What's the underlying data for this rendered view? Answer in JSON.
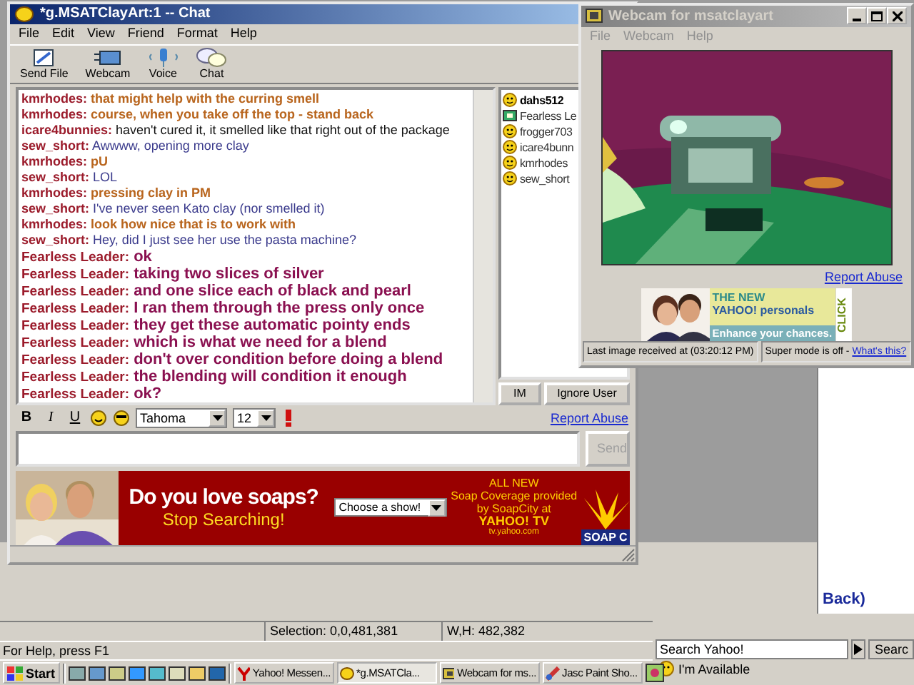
{
  "chat_window": {
    "title": "*g.MSATClayArt:1 -- Chat",
    "menu": [
      "File",
      "Edit",
      "View",
      "Friend",
      "Format",
      "Help"
    ],
    "toolbar": [
      {
        "label": "Send File",
        "kind": "file"
      },
      {
        "label": "Webcam",
        "kind": "webcam"
      },
      {
        "label": "Voice",
        "kind": "voice"
      },
      {
        "label": "Chat",
        "kind": "chat"
      }
    ],
    "messages": [
      {
        "sender": "kmrhodes:",
        "text": "that might help with the curring smell",
        "kind": "bold",
        "color": "#b8641c"
      },
      {
        "sender": "kmrhodes:",
        "text": "course, when you take off the top - stand back",
        "kind": "bold",
        "color": "#b8641c"
      },
      {
        "sender": "icare4bunnies:",
        "text": "haven't cured it, it smelled like that right out of the package",
        "kind": "plain",
        "color": "#111111"
      },
      {
        "sender": "sew_short:",
        "text": "Awwww, opening more clay",
        "kind": "plain",
        "color": "#3a3a8c"
      },
      {
        "sender": "kmrhodes:",
        "text": "pU",
        "kind": "bold",
        "color": "#b8641c"
      },
      {
        "sender": "sew_short:",
        "text": "LOL",
        "kind": "plain",
        "color": "#3a3a8c"
      },
      {
        "sender": "kmrhodes:",
        "text": "pressing clay in PM",
        "kind": "bold",
        "color": "#b8641c"
      },
      {
        "sender": "sew_short:",
        "text": "I've never seen Kato clay (nor smelled it)",
        "kind": "plain",
        "color": "#3a3a8c"
      },
      {
        "sender": "kmrhodes:",
        "text": "look how nice that is to work with",
        "kind": "bold",
        "color": "#b8641c"
      },
      {
        "sender": "sew_short:",
        "text": "Hey, did I just see her use the pasta machine?",
        "kind": "plain",
        "color": "#3a3a8c"
      },
      {
        "sender": "Fearless Leader:",
        "text": "ok",
        "kind": "large",
        "color": "#8a1050"
      },
      {
        "sender": "Fearless Leader:",
        "text": "taking two slices of silver",
        "kind": "large",
        "color": "#8a1050"
      },
      {
        "sender": "Fearless Leader:",
        "text": "and one slice each of black and pearl",
        "kind": "large",
        "color": "#8a1050"
      },
      {
        "sender": "Fearless Leader:",
        "text": "I ran them through the press only once",
        "kind": "large",
        "color": "#8a1050"
      },
      {
        "sender": "Fearless Leader:",
        "text": "they get these automatic pointy ends",
        "kind": "large",
        "color": "#8a1050"
      },
      {
        "sender": "Fearless Leader:",
        "text": "which is what we need for a blend",
        "kind": "large",
        "color": "#8a1050"
      },
      {
        "sender": "Fearless Leader:",
        "text": "don't over condition before doing a blend",
        "kind": "large",
        "color": "#8a1050"
      },
      {
        "sender": "Fearless Leader:",
        "text": "the blending will condition it enough",
        "kind": "large",
        "color": "#8a1050"
      },
      {
        "sender": "Fearless Leader:",
        "text": "ok?",
        "kind": "large",
        "color": "#8a1050"
      }
    ],
    "users": [
      {
        "name": "dahs512",
        "kind": "smiley",
        "current": true
      },
      {
        "name": "Fearless Le",
        "kind": "webcam",
        "current": false
      },
      {
        "name": "frogger703",
        "kind": "smiley",
        "current": false
      },
      {
        "name": "icare4bunn",
        "kind": "smiley",
        "current": false
      },
      {
        "name": "kmrhodes",
        "kind": "smiley",
        "current": false
      },
      {
        "name": "sew_short",
        "kind": "smiley",
        "current": false
      }
    ],
    "user_buttons": [
      "IM",
      "Ignore User"
    ],
    "format_bar": {
      "bold": "B",
      "italic": "I",
      "underline": "U",
      "font": "Tahoma",
      "size": "12"
    },
    "report_abuse": "Report Abuse",
    "send": {
      "label": "Send",
      "disabled": true
    },
    "ad": {
      "headline": "Do you love soaps?",
      "subline": "Stop Searching!",
      "select": "Choose a show!",
      "lines": [
        "ALL NEW",
        "Soap Coverage provided",
        "by SoapCity at"
      ],
      "brand": "YAHOO! TV",
      "url": "tv.yahoo.com",
      "logo": "SOAP C"
    }
  },
  "webcam_window": {
    "title": "Webcam for msatclayart",
    "menu": [
      "File",
      "Webcam",
      "Help"
    ],
    "report_abuse": "Report Abuse",
    "ad": {
      "top": "THE NEW",
      "brand": "YAHOO! personals",
      "tagline": "Enhance your chances.",
      "side": "CLICK"
    },
    "status": "Last image received at (03:20:12 PM)",
    "super_mode": "Super mode is off -",
    "whats_this": "What's this?"
  },
  "paint_window": {
    "selection": "Selection: 0,0,481,381",
    "size": "W,H: 482,382",
    "help": "For Help, press F1"
  },
  "messenger_window": {
    "link": "Back)",
    "search": "Search Yahoo!",
    "search_button": "Searc",
    "status": "I'm Available"
  },
  "taskbar": {
    "start": "Start",
    "tasks": [
      {
        "label": "Yahoo! Messen...",
        "kind": "yahoo",
        "selected": false
      },
      {
        "label": "*g.MSATCla...",
        "kind": "chat",
        "selected": true
      },
      {
        "label": "Webcam for ms...",
        "kind": "webcam",
        "selected": false
      },
      {
        "label": "Jasc Paint Sho...",
        "kind": "paint",
        "selected": false
      }
    ]
  }
}
